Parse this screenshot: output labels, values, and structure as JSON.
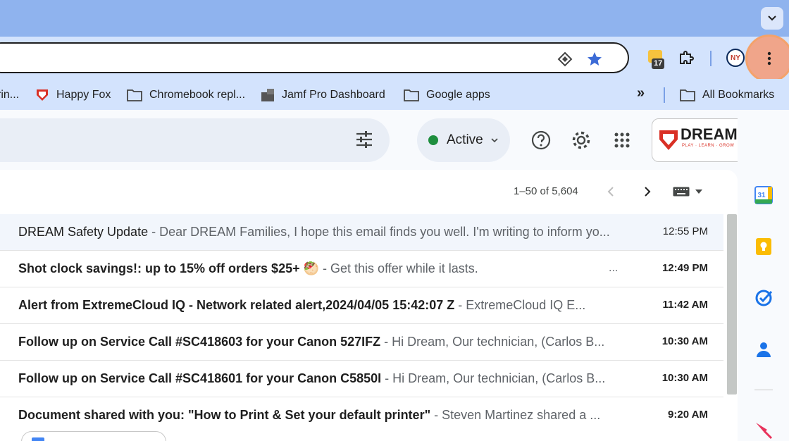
{
  "browser": {
    "extension_badge_count": "17",
    "bookmarks": [
      {
        "label": "rin..."
      },
      {
        "label": "Happy Fox"
      },
      {
        "label": "Chromebook repl..."
      },
      {
        "label": "Jamf Pro Dashboard"
      },
      {
        "label": "Google apps"
      }
    ],
    "all_bookmarks_label": "All Bookmarks",
    "overflow_label": "»"
  },
  "header": {
    "status_label": "Active",
    "account_logo_text": "DREAM",
    "account_logo_tagline": "PLAY · LEARN · GROW"
  },
  "pager": {
    "range_text": "1–50 of 5,604"
  },
  "emails": [
    {
      "subject": "DREAM Safety Update",
      "snippet": " - Dear DREAM Families, I hope this email finds you well. I'm writing to inform yo...",
      "time": "12:55 PM",
      "unread": false
    },
    {
      "subject": "Shot clock savings!: up to 15% off orders $25+ 🥙",
      "snippet": " - Get this offer while it lasts.",
      "time": "12:49 PM",
      "unread": true,
      "trailing": "..."
    },
    {
      "subject": "Alert from ExtremeCloud IQ - Network related alert,2024/04/05 15:42:07 Z",
      "snippet": " - ExtremeCloud IQ E...",
      "time": "11:42 AM",
      "unread": true
    },
    {
      "subject": "Follow up on Service Call #SC418603 for your Canon 527IFZ",
      "snippet": " - Hi Dream, Our technician, (Carlos B...",
      "time": "10:30 AM",
      "unread": true
    },
    {
      "subject": "Follow up on Service Call #SC418601 for your Canon C5850I",
      "snippet": " - Hi Dream, Our technician, (Carlos B...",
      "time": "10:30 AM",
      "unread": true
    },
    {
      "subject": "Document shared with you: \"How to Print & Set your default printer\"",
      "snippet": " - Steven Martinez shared a ...",
      "time": "9:20 AM",
      "unread": true
    }
  ],
  "attachment_chip": {
    "label": ""
  },
  "side_panel": {
    "calendar_day": "31"
  },
  "colors": {
    "tabstrip": "#8fb3ee",
    "toolbar": "#d3e3fd",
    "active_dot": "#1e8e3e",
    "menu_highlight": "#f0a58a",
    "dream_red": "#d93025"
  }
}
